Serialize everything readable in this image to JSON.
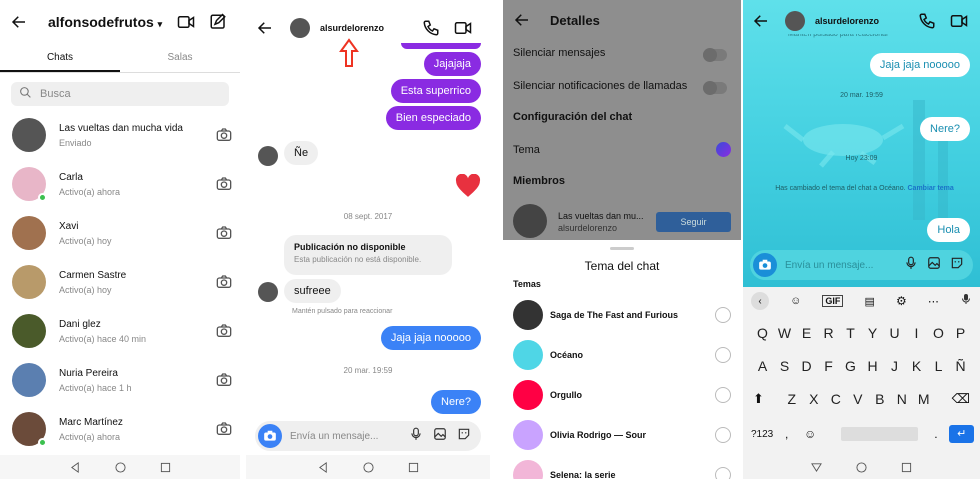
{
  "panel1": {
    "title": "alfonsodefrutos",
    "tabs": [
      "Chats",
      "Salas"
    ],
    "search_placeholder": "Busca",
    "chats": [
      {
        "name": "Las vueltas dan mucha vida",
        "status": "Enviado",
        "online": false,
        "color": "#555"
      },
      {
        "name": "Carla",
        "status": "Activo(a) ahora",
        "online": true,
        "color": "#e8b6c8"
      },
      {
        "name": "Xavi",
        "status": "Activo(a) hoy",
        "online": false,
        "color": "#a0714f"
      },
      {
        "name": "Carmen Sastre",
        "status": "Activo(a) hoy",
        "online": false,
        "color": "#b89a6a"
      },
      {
        "name": "Dani glez",
        "status": "Activo(a) hace 40 min",
        "online": false,
        "color": "#4a5a2a"
      },
      {
        "name": "Nuria Pereira",
        "status": "Activo(a) hace 1 h",
        "online": false,
        "color": "#5b7fb0"
      },
      {
        "name": "Marc Martínez",
        "status": "Activo(a) ahora",
        "online": true,
        "color": "#6b4b3a"
      }
    ]
  },
  "panel2": {
    "contact": "alsurdelorenzo",
    "messages_out": [
      "Jajajaja",
      "Esta superrico",
      "Bien especiado"
    ],
    "reply_1": "Ñe",
    "date_1": "08 sept. 2017",
    "shared_title": "Publicación no disponible",
    "shared_sub": "Esta publicación no está disponible.",
    "reply_2": "sufreee",
    "hint": "Mantén pulsado para reaccionar",
    "out_blue_1": "Jaja jaja nooooo",
    "date_2": "20 mar. 19:59",
    "out_blue_2": "Nere?",
    "composer_placeholder": "Envía un mensaje..."
  },
  "panel3": {
    "title": "Detalles",
    "rows": [
      "Silenciar mensajes",
      "Silenciar notificaciones de llamadas",
      "Configuración del chat",
      "Tema",
      "Miembros"
    ],
    "member_name": "Las vueltas dan mu...",
    "member_user": "alsurdelorenzo",
    "follow": "Seguir",
    "sheet_title": "Tema del chat",
    "section": "Temas",
    "themes": [
      {
        "label": "Saga de The Fast and Furious",
        "color": "#333"
      },
      {
        "label": "Océano",
        "color": "#4fd6e6"
      },
      {
        "label": "Orgullo",
        "color": "#f04"
      },
      {
        "label": "Olivia Rodrigo — Sour",
        "color": "#c9a3ff"
      },
      {
        "label": "Selena: la serie",
        "color": "#f2b6d8"
      }
    ]
  },
  "panel4": {
    "contact": "alsurdelorenzo",
    "top_text": "Mantén pulsado para reaccionar",
    "msg1": "Jaja jaja nooooo",
    "date1": "20 mar. 19:59",
    "msg2": "Nere?",
    "date2": "Hoy 23:09",
    "notice": "Has cambiado el tema del chat a Océano.",
    "notice_link": "Cambiar tema",
    "msg3": "Hola",
    "composer_placeholder": "Envía un mensaje...",
    "kb_tools": [
      "GIF"
    ],
    "row1": [
      "Q",
      "W",
      "E",
      "R",
      "T",
      "Y",
      "U",
      "I",
      "O",
      "P"
    ],
    "row2": [
      "A",
      "S",
      "D",
      "F",
      "G",
      "H",
      "J",
      "K",
      "L",
      "Ñ"
    ],
    "row3": [
      "Z",
      "X",
      "C",
      "V",
      "B",
      "N",
      "M"
    ],
    "sym": "?123",
    "comma": ",",
    "period": "."
  }
}
